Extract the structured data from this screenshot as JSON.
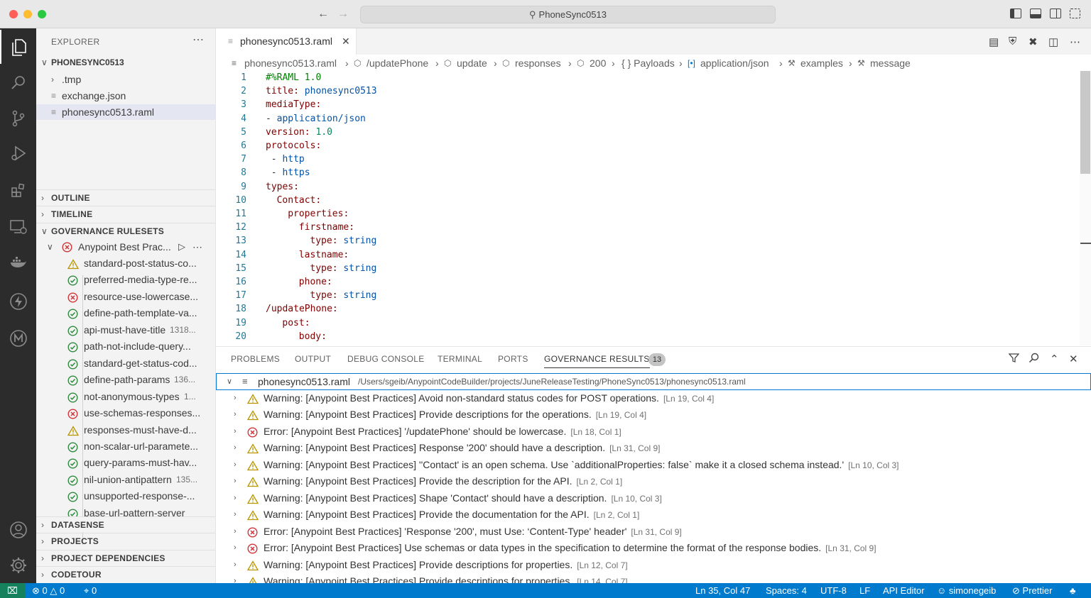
{
  "window": {
    "title": "PhoneSync0513"
  },
  "sidebar": {
    "title": "EXPLORER",
    "project": "PHONESYNC0513",
    "files": [
      ".tmp",
      "exchange.json",
      "phonesync0513.raml"
    ],
    "sections": {
      "outline": "OUTLINE",
      "timeline": "TIMELINE",
      "governance": "GOVERNANCE RULESETS",
      "datasense": "DATASENSE",
      "projects": "PROJECTS",
      "dependencies": "PROJECT DEPENDENCIES",
      "codetour": "CODETOUR"
    },
    "ruleset": {
      "name": "Anypoint Best Prac...",
      "status": "error"
    },
    "rules": [
      {
        "name": "standard-post-status-co...",
        "status": "warn"
      },
      {
        "name": "preferred-media-type-re...",
        "status": "ok"
      },
      {
        "name": "resource-use-lowercase...",
        "status": "err"
      },
      {
        "name": "define-path-template-va...",
        "status": "ok"
      },
      {
        "name": "api-must-have-title",
        "count": "1318...",
        "status": "ok"
      },
      {
        "name": "path-not-include-query...",
        "status": "ok"
      },
      {
        "name": "standard-get-status-cod...",
        "status": "ok"
      },
      {
        "name": "define-path-params",
        "count": "136...",
        "status": "ok"
      },
      {
        "name": "not-anonymous-types",
        "count": "1...",
        "status": "ok"
      },
      {
        "name": "use-schemas-responses...",
        "status": "err"
      },
      {
        "name": "responses-must-have-d...",
        "status": "warn"
      },
      {
        "name": "non-scalar-url-paramete...",
        "status": "ok"
      },
      {
        "name": "query-params-must-hav...",
        "status": "ok"
      },
      {
        "name": "nil-union-antipattern",
        "count": "135...",
        "status": "ok"
      },
      {
        "name": "unsupported-response-...",
        "status": "ok"
      },
      {
        "name": "base-url-pattern-server",
        "status": "ok"
      }
    ]
  },
  "editor": {
    "tab": "phonesync0513.raml",
    "breadcrumb": [
      "phonesync0513.raml",
      "/updatePhone",
      "update",
      "responses",
      "200",
      "{ } Payloads",
      "application/json",
      "examples",
      "message"
    ],
    "lines": [
      {
        "n": "1",
        "key": "#%RAML 1.0",
        "val": "",
        "indent": 0,
        "type": "comment"
      },
      {
        "n": "2",
        "key": "title:",
        "val": "phonesync0513",
        "indent": 0
      },
      {
        "n": "3",
        "key": "mediaType:",
        "val": "",
        "indent": 0
      },
      {
        "n": "4",
        "key": "- ",
        "val": "application/json",
        "indent": 0,
        "dash": true
      },
      {
        "n": "5",
        "key": "version:",
        "val": "1.0",
        "indent": 0,
        "num": true
      },
      {
        "n": "6",
        "key": "protocols:",
        "val": "",
        "indent": 0
      },
      {
        "n": "7",
        "key": "- ",
        "val": "http",
        "indent": 1,
        "dash": true
      },
      {
        "n": "8",
        "key": "- ",
        "val": "https",
        "indent": 1,
        "dash": true
      },
      {
        "n": "9",
        "key": "types:",
        "val": "",
        "indent": 0
      },
      {
        "n": "10",
        "key": "Contact:",
        "val": "",
        "indent": 2
      },
      {
        "n": "11",
        "key": "properties:",
        "val": "",
        "indent": 4
      },
      {
        "n": "12",
        "key": "firstname:",
        "val": "",
        "indent": 6
      },
      {
        "n": "13",
        "key": "type:",
        "val": "string",
        "indent": 8
      },
      {
        "n": "14",
        "key": "lastname:",
        "val": "",
        "indent": 6
      },
      {
        "n": "15",
        "key": "type:",
        "val": "string",
        "indent": 8
      },
      {
        "n": "16",
        "key": "phone:",
        "val": "",
        "indent": 6
      },
      {
        "n": "17",
        "key": "type:",
        "val": "string",
        "indent": 8
      },
      {
        "n": "18",
        "key": "/updatePhone:",
        "val": "",
        "indent": 0
      },
      {
        "n": "19",
        "key": "post:",
        "val": "",
        "indent": 3
      },
      {
        "n": "20",
        "key": "body:",
        "val": "",
        "indent": 6
      }
    ]
  },
  "panel": {
    "tabs": [
      "PROBLEMS",
      "OUTPUT",
      "DEBUG CONSOLE",
      "TERMINAL",
      "PORTS",
      "GOVERNANCE RESULTS"
    ],
    "badge": "13",
    "file": {
      "name": "phonesync0513.raml",
      "path": "/Users/sgeib/AnypointCodeBuilder/projects/JuneReleaseTesting/PhoneSync0513/phonesync0513.raml"
    },
    "results": [
      {
        "status": "warn",
        "msg": "Warning: [Anypoint Best Practices] Avoid non-standard status codes for POST operations.",
        "loc": "[Ln 19, Col 4]"
      },
      {
        "status": "warn",
        "msg": "Warning: [Anypoint Best Practices] Provide descriptions for the operations.",
        "loc": "[Ln 19, Col 4]"
      },
      {
        "status": "err",
        "msg": "Error: [Anypoint Best Practices] '/updatePhone' should be lowercase.",
        "loc": "[Ln 18, Col 1]"
      },
      {
        "status": "warn",
        "msg": "Warning: [Anypoint Best Practices] Response '200' should have a description.",
        "loc": "[Ln 31, Col 9]"
      },
      {
        "status": "warn",
        "msg": "Warning: [Anypoint Best Practices] ''Contact' is an open schema. Use `additionalProperties: false` make it a closed schema instead.'",
        "loc": "[Ln 10, Col 3]"
      },
      {
        "status": "warn",
        "msg": "Warning: [Anypoint Best Practices] Provide the description for the API.",
        "loc": "[Ln 2, Col 1]"
      },
      {
        "status": "warn",
        "msg": "Warning: [Anypoint Best Practices] Shape 'Contact' should have a description.",
        "loc": "[Ln 10, Col 3]"
      },
      {
        "status": "warn",
        "msg": "Warning: [Anypoint Best Practices] Provide the documentation for the API.",
        "loc": "[Ln 2, Col 1]"
      },
      {
        "status": "err",
        "msg": "Error: [Anypoint Best Practices] 'Response '200', must Use: ‘Content-Type' header'",
        "loc": "[Ln 31, Col 9]"
      },
      {
        "status": "err",
        "msg": "Error: [Anypoint Best Practices] Use schemas or data types in the specification to determine the format of the response bodies.",
        "loc": "[Ln 31, Col 9]"
      },
      {
        "status": "warn",
        "msg": "Warning: [Anypoint Best Practices] Provide descriptions for properties.",
        "loc": "[Ln 12, Col 7]"
      },
      {
        "status": "warn",
        "msg": "Warning: [Anypoint Best Practices] Provide descriptions for properties.",
        "loc": "[Ln 14, Col 7]"
      }
    ]
  },
  "statusbar": {
    "errors": "0",
    "warnings": "0",
    "ports": "0",
    "cursor": "Ln 35, Col 47",
    "spaces": "Spaces: 4",
    "encoding": "UTF-8",
    "eol": "LF",
    "mode": "API Editor",
    "user": "simonegeib",
    "prettier": "Prettier"
  },
  "colors": {
    "accent": "#007acc",
    "error": "#d13438",
    "ok": "#2e8b3e",
    "warn": "#b89500"
  }
}
